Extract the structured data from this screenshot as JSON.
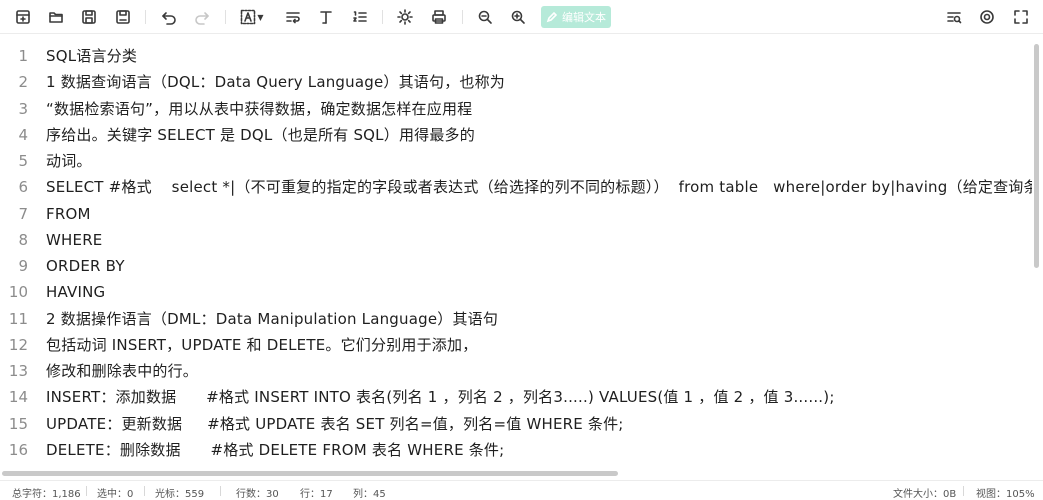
{
  "toolbar": {
    "icons": [
      "new-file-icon",
      "open-folder-icon",
      "save-icon",
      "save-as-icon",
      "undo-icon",
      "redo-icon",
      "font-select-icon",
      "wrap-icon",
      "text-style-icon",
      "list-numbers-icon",
      "brightness-icon",
      "print-icon",
      "zoom-out-icon",
      "zoom-in-icon",
      "find-replace-icon",
      "settings-icon",
      "fullscreen-icon"
    ],
    "edit_label": "编辑文本"
  },
  "editor": {
    "lines": [
      {
        "num": "1",
        "text": "SQL语言分类"
      },
      {
        "num": "2",
        "text": "1 数据查询语言（DQL：Data Query Language）其语句，也称为"
      },
      {
        "num": "3",
        "text": "“数据检索语句”，用以从表中获得数据，确定数据怎样在应用程"
      },
      {
        "num": "4",
        "text": "序给出。关键字 SELECT 是 DQL（也是所有 SQL）用得最多的"
      },
      {
        "num": "5",
        "text": "动词。"
      },
      {
        "num": "6",
        "text": "SELECT #格式    select *|（不可重复的指定的字段或者表达式（给选择的列不同的标题））  from table   where|order by|having（给定查询条件）"
      },
      {
        "num": "7",
        "text": "FROM"
      },
      {
        "num": "8",
        "text": "WHERE"
      },
      {
        "num": "9",
        "text": "ORDER BY"
      },
      {
        "num": "10",
        "text": "HAVING"
      },
      {
        "num": "11",
        "text": "2 数据操作语言（DML：Data Manipulation Language）其语句"
      },
      {
        "num": "12",
        "text": "包括动词 INSERT，UPDATE 和 DELETE。它们分别用于添加，"
      },
      {
        "num": "13",
        "text": "修改和删除表中的行。"
      },
      {
        "num": "14",
        "text": "INSERT：添加数据      #格式 INSERT INTO 表名(列名 1 ，列名 2 ，列名3.....) VALUES(值 1 ，值 2 ，值 3......);"
      },
      {
        "num": "15",
        "text": "UPDATE：更新数据     #格式 UPDATE 表名 SET 列名=值，列名=值 WHERE 条件;"
      },
      {
        "num": "16",
        "text": "DELETE：删除数据      #格式 DELETE FROM 表名 WHERE 条件;"
      }
    ]
  },
  "status": {
    "chars": "总字符：1,186",
    "selected": "选中：0",
    "cursor": "光标：559",
    "rows": "行数：30",
    "row": "行：17",
    "col": "列：45",
    "filesize": "文件大小：0B",
    "zoom": "视图：105%"
  }
}
